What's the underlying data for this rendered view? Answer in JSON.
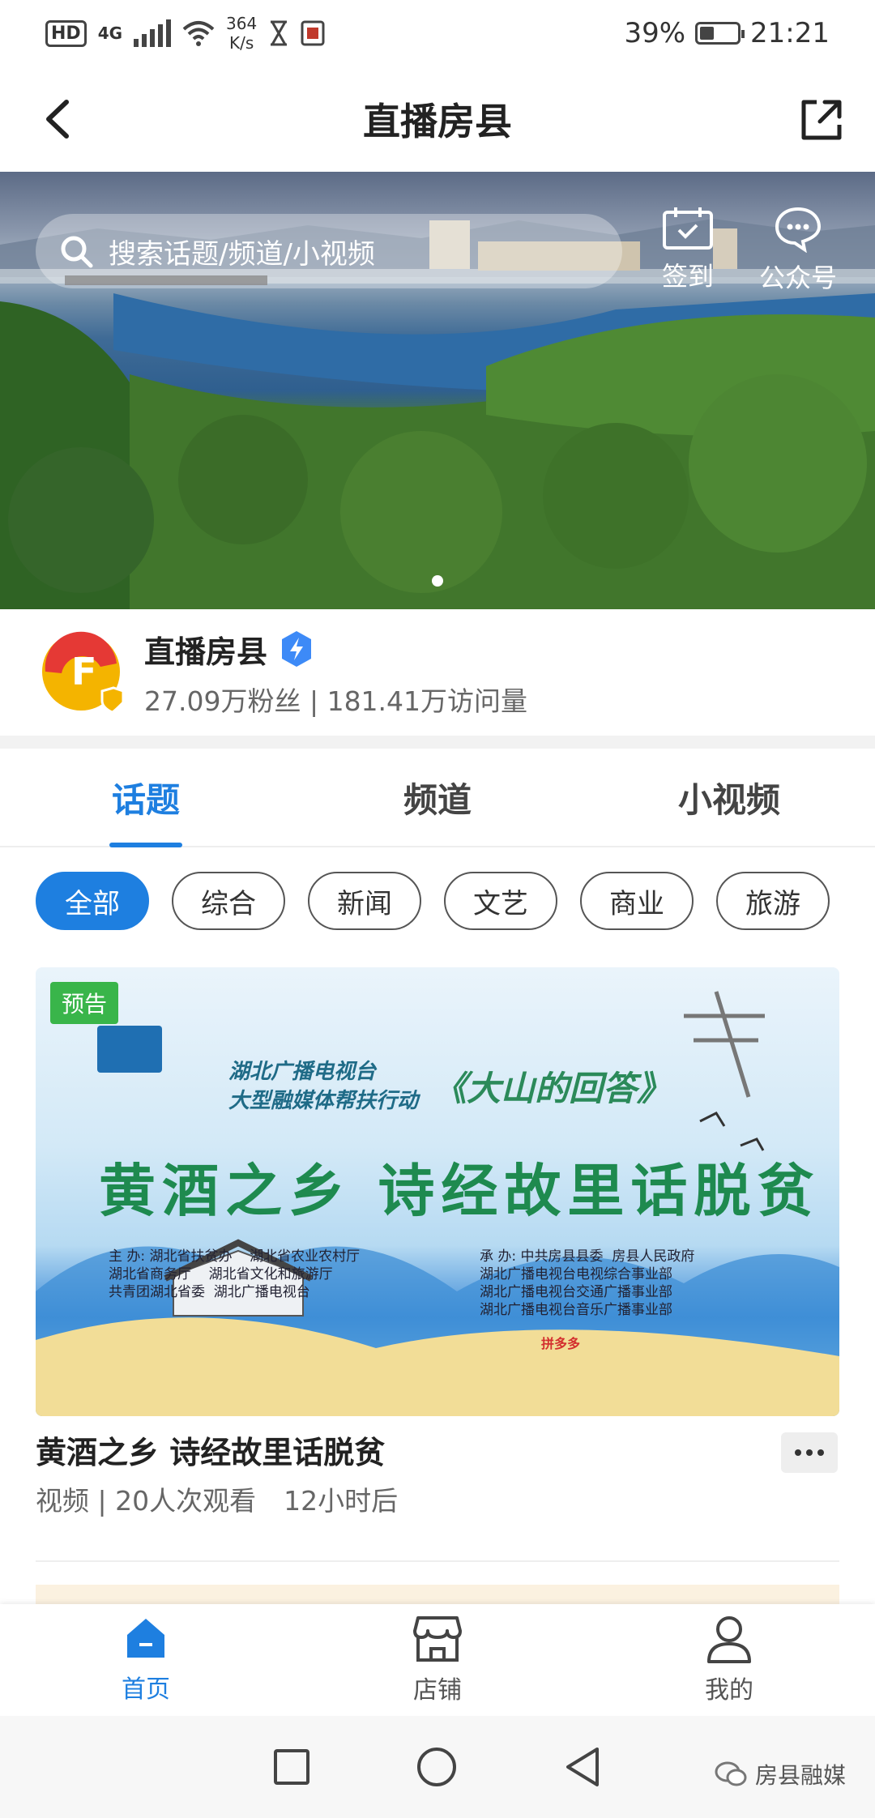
{
  "status_bar": {
    "hd": "HD",
    "network": "4G",
    "speed_value": "364",
    "speed_unit": "K/s",
    "battery_percent": "39%",
    "time": "21:21"
  },
  "nav": {
    "title": "直播房县"
  },
  "banner": {
    "search_placeholder": "搜索话题/频道/小视频",
    "checkin_label": "签到",
    "public_account_label": "公众号"
  },
  "profile": {
    "name": "直播房县",
    "stats": "27.09万粉丝 | 181.41万访问量"
  },
  "tabs": [
    {
      "label": "话题",
      "active": true
    },
    {
      "label": "频道",
      "active": false
    },
    {
      "label": "小视频",
      "active": false
    }
  ],
  "chips": [
    {
      "label": "全部",
      "active": true
    },
    {
      "label": "综合",
      "active": false
    },
    {
      "label": "新闻",
      "active": false
    },
    {
      "label": "文艺",
      "active": false
    },
    {
      "label": "商业",
      "active": false
    },
    {
      "label": "旅游",
      "active": false
    }
  ],
  "card": {
    "badge": "预告",
    "poster": {
      "org_line1": "湖北广播电视台",
      "org_line2": "大型融媒体帮扶行动",
      "slogan": "《大山的回答》",
      "headline": "黄酒之乡 诗经故里话脱贫",
      "hosts": "主 办: 湖北省扶贫办    湖北省农业农村厅\n湖北省商务厅    湖北省文化和旅游厅\n共青团湖北省委  湖北广播电视台",
      "organizers": "承 办: 中共房县县委  房县人民政府\n湖北广播电视台电视综合事业部\n湖北广播电视台交通广播事业部\n湖北广播电视台音乐广播事业部",
      "sponsor": "拼多多"
    },
    "title": "黄酒之乡 诗经故里话脱贫",
    "meta_type_views": "视频 | 20人次观看",
    "meta_time": "12小时后"
  },
  "bottom_nav": [
    {
      "label": "首页",
      "icon": "home-icon",
      "active": true
    },
    {
      "label": "店铺",
      "icon": "shop-icon",
      "active": false
    },
    {
      "label": "我的",
      "icon": "profile-icon",
      "active": false
    }
  ],
  "watermark": "房县融媒",
  "colors": {
    "accent": "#1e7fe0",
    "badge_green": "#39b54a"
  }
}
